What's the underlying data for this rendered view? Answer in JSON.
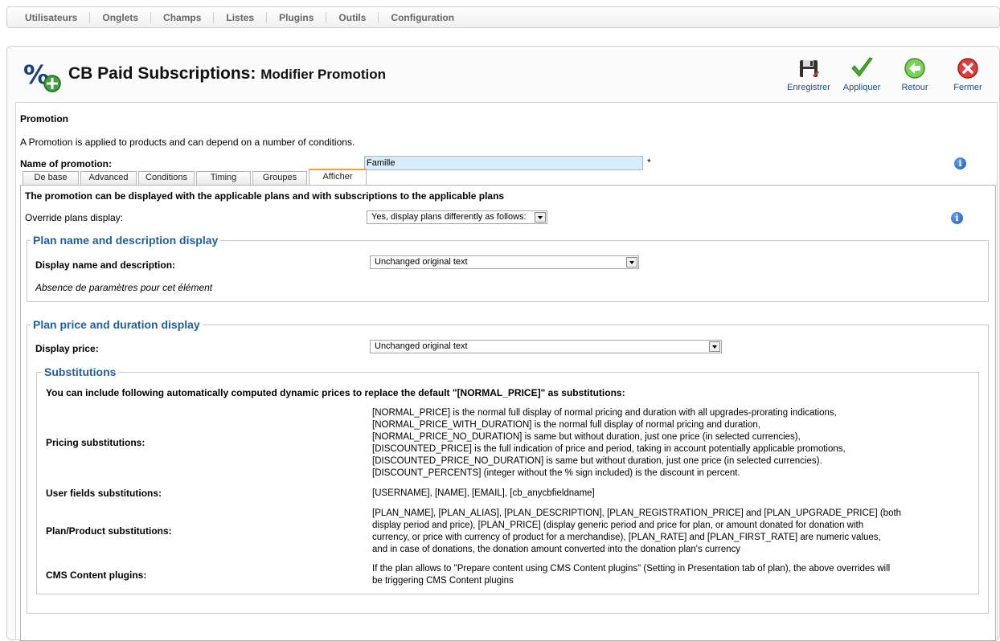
{
  "menu": [
    "Utilisateurs",
    "Onglets",
    "Champs",
    "Listes",
    "Plugins",
    "Outils",
    "Configuration"
  ],
  "header": {
    "title": "CB Paid Subscriptions:",
    "subtitle": "Modifier Promotion"
  },
  "toolbar": {
    "save": "Enregistrer",
    "apply": "Appliquer",
    "back": "Retour",
    "close": "Fermer"
  },
  "form": {
    "section_title": "Promotion",
    "description": "A Promotion is applied to products and can depend on a number of conditions.",
    "name_label": "Name of promotion:",
    "name_value": "Famille",
    "required_mark": "*"
  },
  "tabs": [
    "De base",
    "Advanced",
    "Conditions",
    "Timing",
    "Groupes",
    "Afficher"
  ],
  "display_tab": {
    "intro": "The promotion can be displayed with the applicable plans and with subscriptions to the applicable plans",
    "override_label": "Override plans display:",
    "override_value": "Yes, display plans differently as follows:",
    "name_desc_group": {
      "legend": "Plan name and description display",
      "label": "Display name and description:",
      "value": "Unchanged original text",
      "note": "Absence de paramètres pour cet élément"
    },
    "price_group": {
      "legend": "Plan price and duration display",
      "label": "Display price:",
      "value": "Unchanged original text"
    },
    "substitutions": {
      "legend": "Substitutions",
      "intro": "You can include following automatically computed dynamic prices to replace the default \"[NORMAL_PRICE]\" as substitutions:",
      "pricing_label": "Pricing substitutions:",
      "pricing_lines": [
        "[NORMAL_PRICE] is the normal full display of normal pricing and duration with all upgrades-prorating indications,",
        "[NORMAL_PRICE_WITH_DURATION] is the normal full display of normal pricing and duration,",
        "[NORMAL_PRICE_NO_DURATION] is same but without duration, just one price (in selected currencies),",
        "[DISCOUNTED_PRICE] is the full indication of price and period, taking in account potentially applicable promotions,",
        "[DISCOUNTED_PRICE_NO_DURATION] is same but without duration, just one price (in selected currencies).",
        "[DISCOUNT_PERCENTS] (integer without the % sign included) is the discount in percent."
      ],
      "user_label": "User fields substitutions:",
      "user_value": "[USERNAME], [NAME], [EMAIL], [cb_anycbfieldname]",
      "plan_label": "Plan/Product substitutions:",
      "plan_lines": [
        "[PLAN_NAME], [PLAN_ALIAS], [PLAN_DESCRIPTION], [PLAN_REGISTRATION_PRICE] and [PLAN_UPGRADE_PRICE] (both",
        "display period and price), [PLAN_PRICE] (display generic period and price for plan, or amount donated for donation with",
        "currency, or price with currency of product for a merchandise), [PLAN_RATE] and [PLAN_FIRST_RATE] are numeric values,",
        "and in case of donations, the donation amount converted into the donation plan's currency"
      ],
      "cms_label": "CMS Content plugins:",
      "cms_lines": [
        "If the plan allows to \"Prepare content using CMS Content plugins\" (Setting in Presentation tab of plan), the above overrides will",
        "be triggering CMS Content plugins"
      ]
    }
  }
}
